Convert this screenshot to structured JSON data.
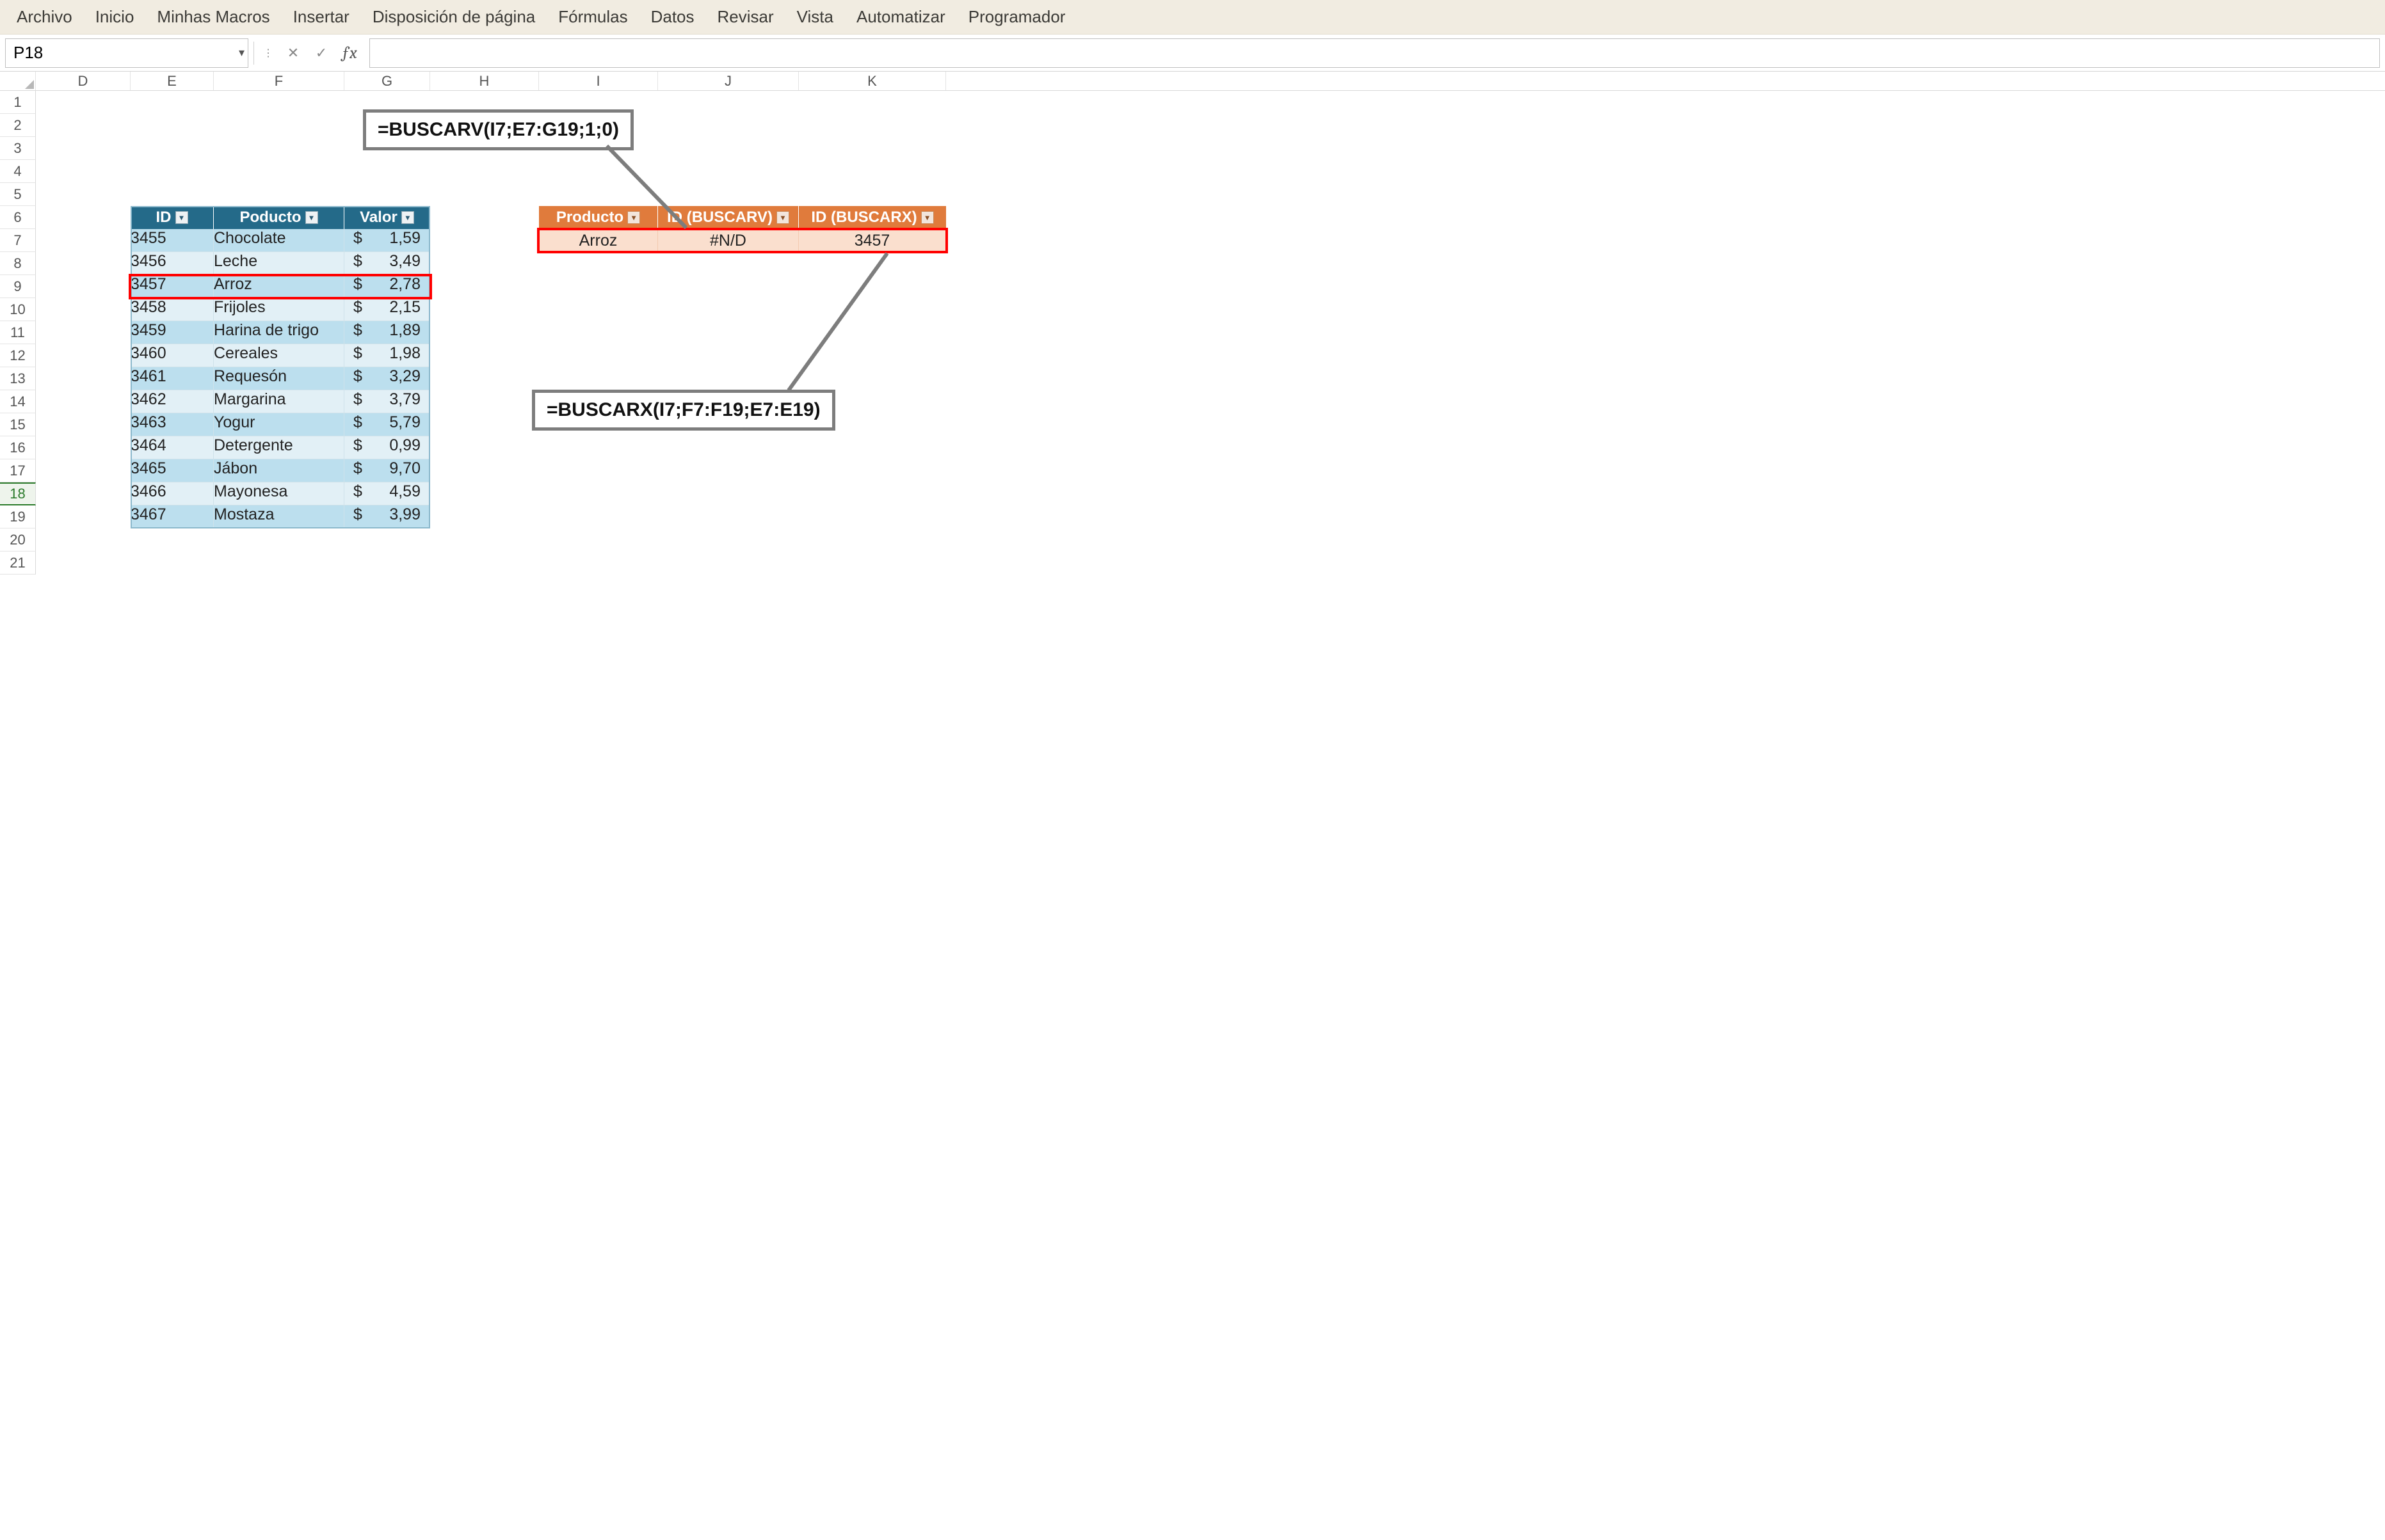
{
  "menu": {
    "items": [
      "Archivo",
      "Inicio",
      "Minhas Macros",
      "Insertar",
      "Disposición de página",
      "Fórmulas",
      "Datos",
      "Revisar",
      "Vista",
      "Automatizar",
      "Programador"
    ]
  },
  "formula_bar": {
    "name_box": "P18",
    "formula": ""
  },
  "columns": [
    "D",
    "E",
    "F",
    "G",
    "H",
    "I",
    "J",
    "K"
  ],
  "row_numbers": [
    "1",
    "2",
    "3",
    "4",
    "5",
    "6",
    "7",
    "8",
    "9",
    "10",
    "11",
    "12",
    "13",
    "14",
    "15",
    "16",
    "17",
    "18",
    "19",
    "20",
    "21"
  ],
  "blue_table": {
    "headers": {
      "id": "ID",
      "prod": "Poducto",
      "val": "Valor"
    },
    "currency": "$",
    "rows": [
      {
        "id": "3455",
        "prod": "Chocolate",
        "val": "1,59"
      },
      {
        "id": "3456",
        "prod": "Leche",
        "val": "3,49"
      },
      {
        "id": "3457",
        "prod": "Arroz",
        "val": "2,78"
      },
      {
        "id": "3458",
        "prod": "Frijoles",
        "val": "2,15"
      },
      {
        "id": "3459",
        "prod": "Harina de trigo",
        "val": "1,89"
      },
      {
        "id": "3460",
        "prod": "Cereales",
        "val": "1,98"
      },
      {
        "id": "3461",
        "prod": "Requesón",
        "val": "3,29"
      },
      {
        "id": "3462",
        "prod": "Margarina",
        "val": "3,79"
      },
      {
        "id": "3463",
        "prod": "Yogur",
        "val": "5,79"
      },
      {
        "id": "3464",
        "prod": "Detergente",
        "val": "0,99"
      },
      {
        "id": "3465",
        "prod": "Jábon",
        "val": "9,70"
      },
      {
        "id": "3466",
        "prod": "Mayonesa",
        "val": "4,59"
      },
      {
        "id": "3467",
        "prod": "Mostaza",
        "val": "3,99"
      }
    ],
    "highlight_index": 2
  },
  "orange_table": {
    "headers": {
      "prod": "Producto",
      "idv": "ID (BUSCARV)",
      "idx": "ID (BUSCARX)"
    },
    "row": {
      "prod": "Arroz",
      "idv": "#N/D",
      "idx": "3457"
    }
  },
  "callouts": {
    "top": "=BUSCARV(I7;E7:G19;1;0)",
    "bottom": "=BUSCARX(I7;F7:F19;E7:E19)"
  }
}
